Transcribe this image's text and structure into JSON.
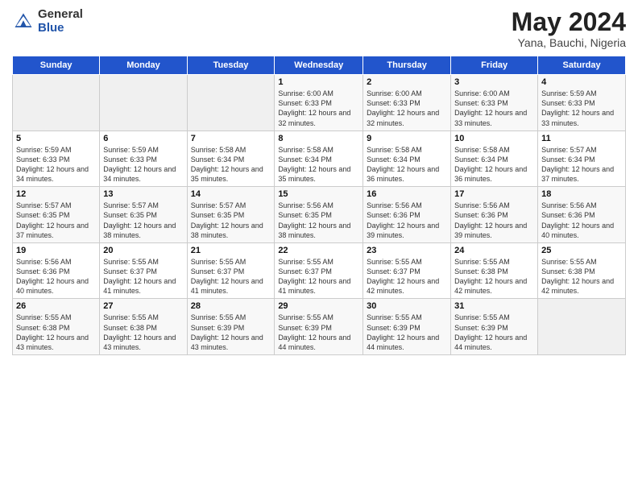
{
  "header": {
    "logo_general": "General",
    "logo_blue": "Blue",
    "title": "May 2024",
    "location": "Yana, Bauchi, Nigeria"
  },
  "days_of_week": [
    "Sunday",
    "Monday",
    "Tuesday",
    "Wednesday",
    "Thursday",
    "Friday",
    "Saturday"
  ],
  "weeks": [
    [
      {
        "day": "",
        "info": ""
      },
      {
        "day": "",
        "info": ""
      },
      {
        "day": "",
        "info": ""
      },
      {
        "day": "1",
        "info": "Sunrise: 6:00 AM\nSunset: 6:33 PM\nDaylight: 12 hours\nand 32 minutes."
      },
      {
        "day": "2",
        "info": "Sunrise: 6:00 AM\nSunset: 6:33 PM\nDaylight: 12 hours\nand 32 minutes."
      },
      {
        "day": "3",
        "info": "Sunrise: 6:00 AM\nSunset: 6:33 PM\nDaylight: 12 hours\nand 33 minutes."
      },
      {
        "day": "4",
        "info": "Sunrise: 5:59 AM\nSunset: 6:33 PM\nDaylight: 12 hours\nand 33 minutes."
      }
    ],
    [
      {
        "day": "5",
        "info": "Sunrise: 5:59 AM\nSunset: 6:33 PM\nDaylight: 12 hours\nand 34 minutes."
      },
      {
        "day": "6",
        "info": "Sunrise: 5:59 AM\nSunset: 6:33 PM\nDaylight: 12 hours\nand 34 minutes."
      },
      {
        "day": "7",
        "info": "Sunrise: 5:58 AM\nSunset: 6:34 PM\nDaylight: 12 hours\nand 35 minutes."
      },
      {
        "day": "8",
        "info": "Sunrise: 5:58 AM\nSunset: 6:34 PM\nDaylight: 12 hours\nand 35 minutes."
      },
      {
        "day": "9",
        "info": "Sunrise: 5:58 AM\nSunset: 6:34 PM\nDaylight: 12 hours\nand 36 minutes."
      },
      {
        "day": "10",
        "info": "Sunrise: 5:58 AM\nSunset: 6:34 PM\nDaylight: 12 hours\nand 36 minutes."
      },
      {
        "day": "11",
        "info": "Sunrise: 5:57 AM\nSunset: 6:34 PM\nDaylight: 12 hours\nand 37 minutes."
      }
    ],
    [
      {
        "day": "12",
        "info": "Sunrise: 5:57 AM\nSunset: 6:35 PM\nDaylight: 12 hours\nand 37 minutes."
      },
      {
        "day": "13",
        "info": "Sunrise: 5:57 AM\nSunset: 6:35 PM\nDaylight: 12 hours\nand 38 minutes."
      },
      {
        "day": "14",
        "info": "Sunrise: 5:57 AM\nSunset: 6:35 PM\nDaylight: 12 hours\nand 38 minutes."
      },
      {
        "day": "15",
        "info": "Sunrise: 5:56 AM\nSunset: 6:35 PM\nDaylight: 12 hours\nand 38 minutes."
      },
      {
        "day": "16",
        "info": "Sunrise: 5:56 AM\nSunset: 6:36 PM\nDaylight: 12 hours\nand 39 minutes."
      },
      {
        "day": "17",
        "info": "Sunrise: 5:56 AM\nSunset: 6:36 PM\nDaylight: 12 hours\nand 39 minutes."
      },
      {
        "day": "18",
        "info": "Sunrise: 5:56 AM\nSunset: 6:36 PM\nDaylight: 12 hours\nand 40 minutes."
      }
    ],
    [
      {
        "day": "19",
        "info": "Sunrise: 5:56 AM\nSunset: 6:36 PM\nDaylight: 12 hours\nand 40 minutes."
      },
      {
        "day": "20",
        "info": "Sunrise: 5:55 AM\nSunset: 6:37 PM\nDaylight: 12 hours\nand 41 minutes."
      },
      {
        "day": "21",
        "info": "Sunrise: 5:55 AM\nSunset: 6:37 PM\nDaylight: 12 hours\nand 41 minutes."
      },
      {
        "day": "22",
        "info": "Sunrise: 5:55 AM\nSunset: 6:37 PM\nDaylight: 12 hours\nand 41 minutes."
      },
      {
        "day": "23",
        "info": "Sunrise: 5:55 AM\nSunset: 6:37 PM\nDaylight: 12 hours\nand 42 minutes."
      },
      {
        "day": "24",
        "info": "Sunrise: 5:55 AM\nSunset: 6:38 PM\nDaylight: 12 hours\nand 42 minutes."
      },
      {
        "day": "25",
        "info": "Sunrise: 5:55 AM\nSunset: 6:38 PM\nDaylight: 12 hours\nand 42 minutes."
      }
    ],
    [
      {
        "day": "26",
        "info": "Sunrise: 5:55 AM\nSunset: 6:38 PM\nDaylight: 12 hours\nand 43 minutes."
      },
      {
        "day": "27",
        "info": "Sunrise: 5:55 AM\nSunset: 6:38 PM\nDaylight: 12 hours\nand 43 minutes."
      },
      {
        "day": "28",
        "info": "Sunrise: 5:55 AM\nSunset: 6:39 PM\nDaylight: 12 hours\nand 43 minutes."
      },
      {
        "day": "29",
        "info": "Sunrise: 5:55 AM\nSunset: 6:39 PM\nDaylight: 12 hours\nand 44 minutes."
      },
      {
        "day": "30",
        "info": "Sunrise: 5:55 AM\nSunset: 6:39 PM\nDaylight: 12 hours\nand 44 minutes."
      },
      {
        "day": "31",
        "info": "Sunrise: 5:55 AM\nSunset: 6:39 PM\nDaylight: 12 hours\nand 44 minutes."
      },
      {
        "day": "",
        "info": ""
      }
    ]
  ]
}
